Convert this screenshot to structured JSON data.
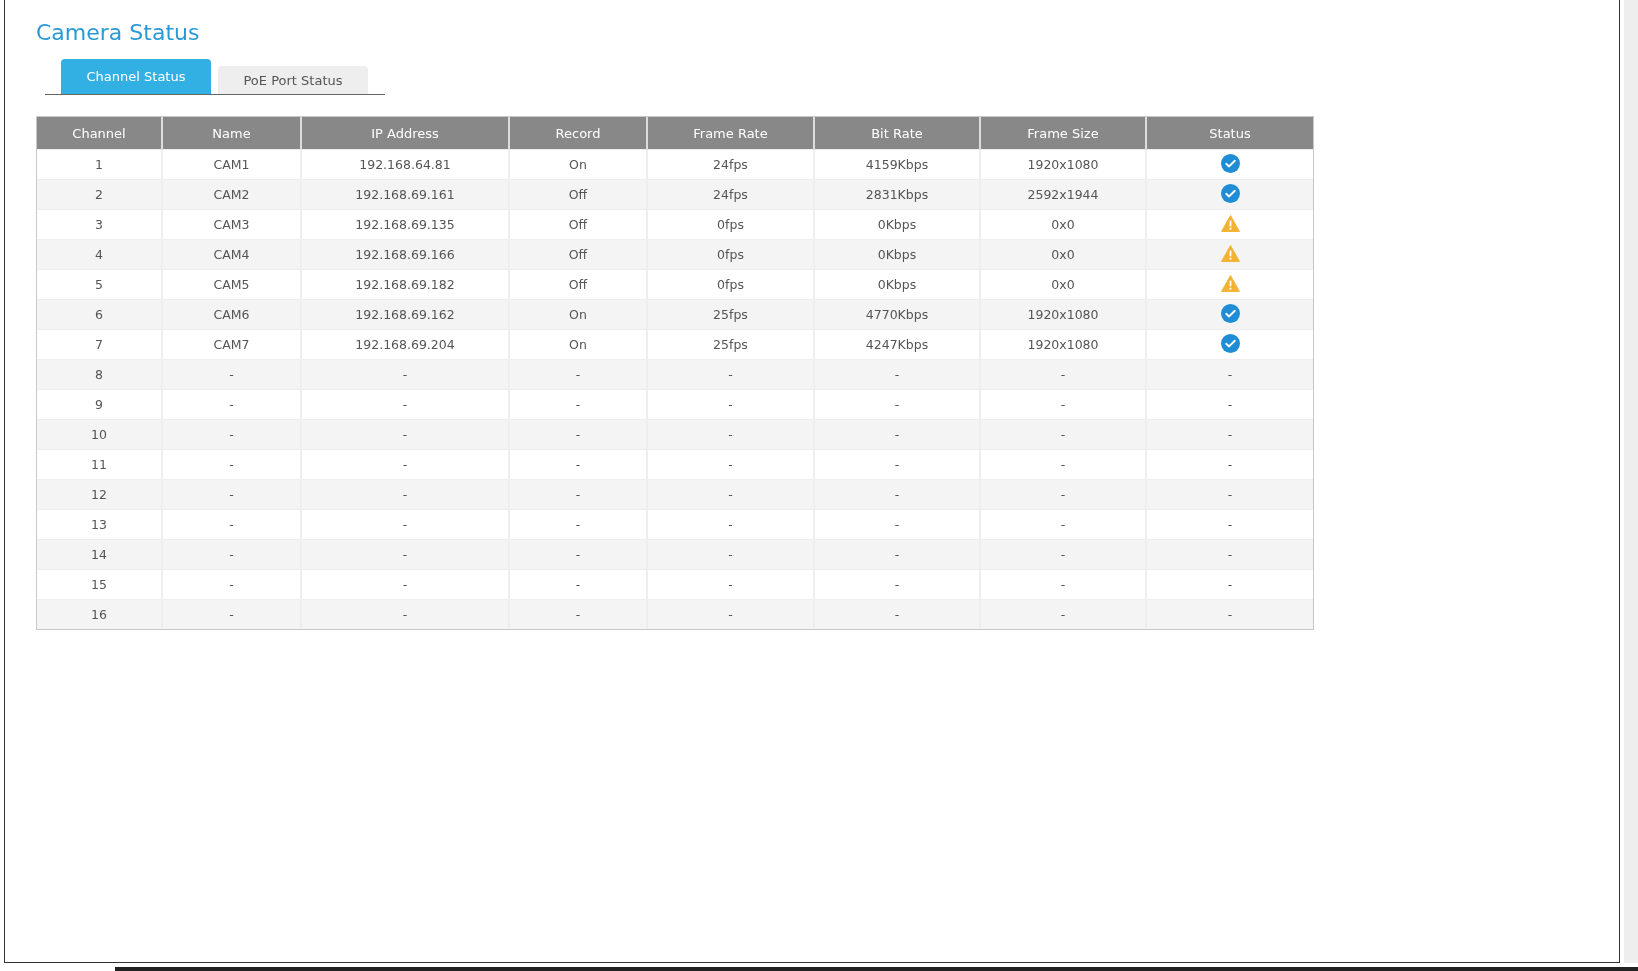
{
  "page": {
    "title": "Camera Status"
  },
  "tabs": [
    {
      "label": "Channel Status",
      "selected": true
    },
    {
      "label": "PoE Port Status",
      "selected": false
    }
  ],
  "table": {
    "columns": [
      "Channel",
      "Name",
      "IP Address",
      "Record",
      "Frame Rate",
      "Bit Rate",
      "Frame Size",
      "Status"
    ],
    "rows": [
      {
        "cells": [
          "1",
          "CAM1",
          "192.168.64.81",
          "On",
          "24fps",
          "4159Kbps",
          "1920x1080"
        ],
        "status": {
          "kind": "ok"
        }
      },
      {
        "cells": [
          "2",
          "CAM2",
          "192.168.69.161",
          "Off",
          "24fps",
          "2831Kbps",
          "2592x1944"
        ],
        "status": {
          "kind": "ok"
        }
      },
      {
        "cells": [
          "3",
          "CAM3",
          "192.168.69.135",
          "Off",
          "0fps",
          "0Kbps",
          "0x0"
        ],
        "status": {
          "kind": "warning"
        }
      },
      {
        "cells": [
          "4",
          "CAM4",
          "192.168.69.166",
          "Off",
          "0fps",
          "0Kbps",
          "0x0"
        ],
        "status": {
          "kind": "warning"
        }
      },
      {
        "cells": [
          "5",
          "CAM5",
          "192.168.69.182",
          "Off",
          "0fps",
          "0Kbps",
          "0x0"
        ],
        "status": {
          "kind": "warning"
        }
      },
      {
        "cells": [
          "6",
          "CAM6",
          "192.168.69.162",
          "On",
          "25fps",
          "4770Kbps",
          "1920x1080"
        ],
        "status": {
          "kind": "ok"
        }
      },
      {
        "cells": [
          "7",
          "CAM7",
          "192.168.69.204",
          "On",
          "25fps",
          "4247Kbps",
          "1920x1080"
        ],
        "status": {
          "kind": "ok"
        }
      },
      {
        "cells": [
          "8",
          "-",
          "-",
          "-",
          "-",
          "-",
          "-"
        ],
        "status": {
          "kind": "text",
          "text": "-"
        }
      },
      {
        "cells": [
          "9",
          "-",
          "-",
          "-",
          "-",
          "-",
          "-"
        ],
        "status": {
          "kind": "text",
          "text": "-"
        }
      },
      {
        "cells": [
          "10",
          "-",
          "-",
          "-",
          "-",
          "-",
          "-"
        ],
        "status": {
          "kind": "text",
          "text": "-"
        }
      },
      {
        "cells": [
          "11",
          "-",
          "-",
          "-",
          "-",
          "-",
          "-"
        ],
        "status": {
          "kind": "text",
          "text": "-"
        }
      },
      {
        "cells": [
          "12",
          "-",
          "-",
          "-",
          "-",
          "-",
          "-"
        ],
        "status": {
          "kind": "text",
          "text": "-"
        }
      },
      {
        "cells": [
          "13",
          "-",
          "-",
          "-",
          "-",
          "-",
          "-"
        ],
        "status": {
          "kind": "text",
          "text": "-"
        }
      },
      {
        "cells": [
          "14",
          "-",
          "-",
          "-",
          "-",
          "-",
          "-"
        ],
        "status": {
          "kind": "text",
          "text": "-"
        }
      },
      {
        "cells": [
          "15",
          "-",
          "-",
          "-",
          "-",
          "-",
          "-"
        ],
        "status": {
          "kind": "text",
          "text": "-"
        }
      },
      {
        "cells": [
          "16",
          "-",
          "-",
          "-",
          "-",
          "-",
          "-"
        ],
        "status": {
          "kind": "text",
          "text": "-"
        }
      }
    ]
  }
}
